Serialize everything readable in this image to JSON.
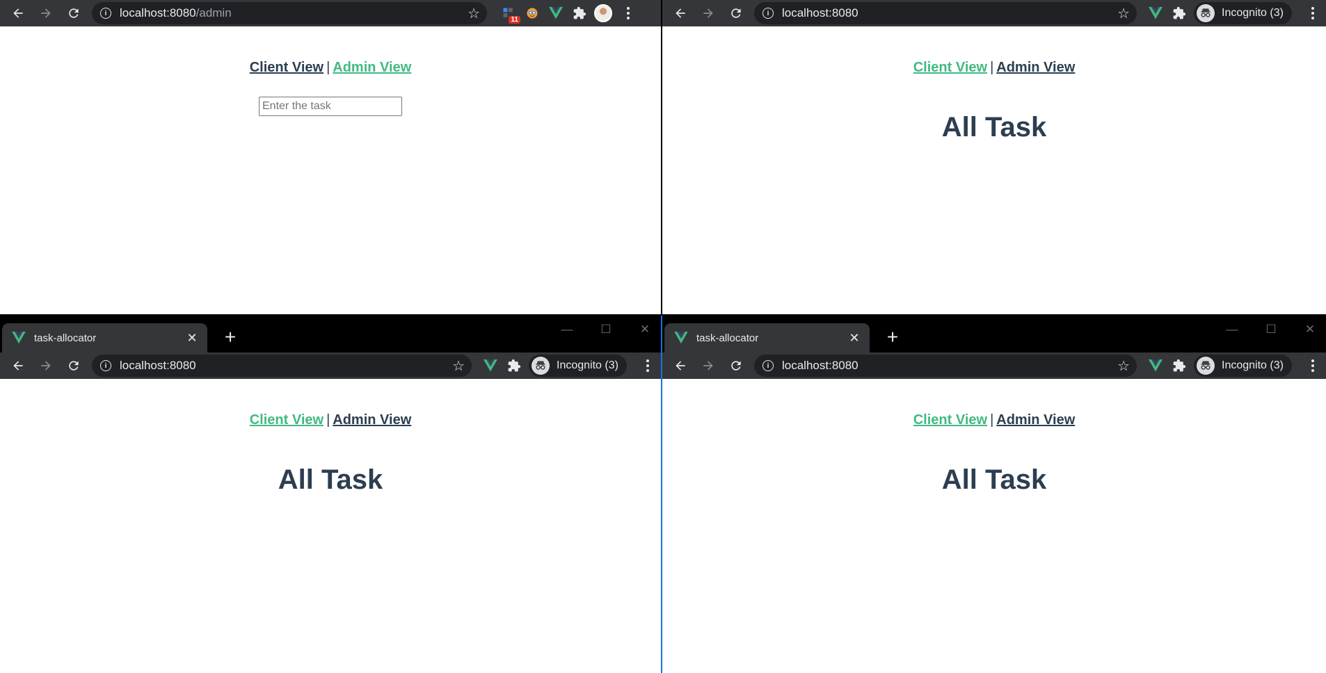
{
  "colors": {
    "link_active": "#42b983",
    "link_default": "#2c3e50",
    "chrome_dark": "#35363a",
    "omnibox": "#202124"
  },
  "top_left": {
    "url_host": "localhost:8080",
    "url_path": "/admin",
    "extension_badge": "11",
    "nav": {
      "client_view": "Client View",
      "separator": "|",
      "admin_view": "Admin View",
      "active": "admin"
    },
    "task_input": {
      "placeholder": "Enter the task",
      "value": ""
    }
  },
  "top_right": {
    "url_host": "localhost:8080",
    "incognito_label": "Incognito (3)",
    "nav": {
      "client_view": "Client View",
      "separator": "|",
      "admin_view": "Admin View",
      "active": "client"
    },
    "heading": "All Task"
  },
  "bottom_left": {
    "tab_title": "task-allocator",
    "url_host": "localhost:8080",
    "incognito_label": "Incognito (3)",
    "nav": {
      "client_view": "Client View",
      "separator": "|",
      "admin_view": "Admin View",
      "active": "client"
    },
    "heading": "All Task"
  },
  "bottom_right": {
    "tab_title": "task-allocator",
    "url_host": "localhost:8080",
    "incognito_label": "Incognito (3)",
    "nav": {
      "client_view": "Client View",
      "separator": "|",
      "admin_view": "Admin View",
      "active": "client"
    },
    "heading": "All Task"
  }
}
